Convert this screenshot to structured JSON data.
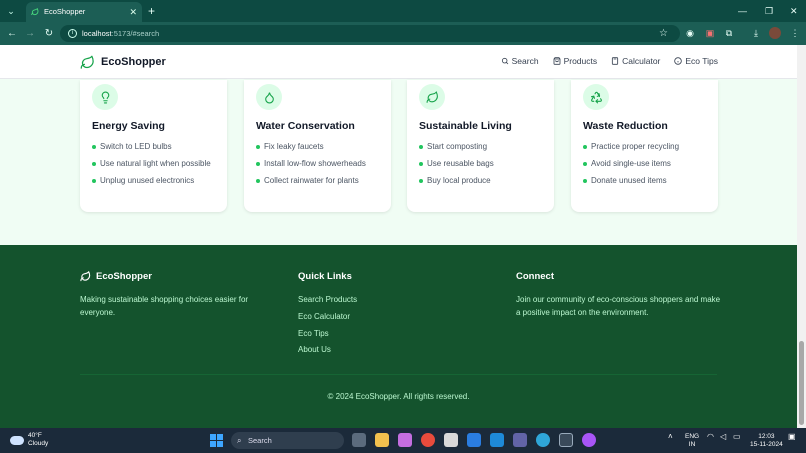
{
  "browser": {
    "tab_title": "EcoShopper",
    "url_host": "localhost",
    "url_rest": ":5173/#search"
  },
  "app": {
    "brand": "EcoShopper",
    "nav": [
      {
        "label": "Search",
        "icon": "search-icon"
      },
      {
        "label": "Products",
        "icon": "shopping-bag-icon"
      },
      {
        "label": "Calculator",
        "icon": "calculator-icon"
      },
      {
        "label": "Eco Tips",
        "icon": "info-icon"
      }
    ]
  },
  "tips": [
    {
      "title": "Energy Saving",
      "icon": "lightbulb-icon",
      "items": [
        "Switch to LED bulbs",
        "Use natural light when possible",
        "Unplug unused electronics"
      ]
    },
    {
      "title": "Water Conservation",
      "icon": "droplet-icon",
      "items": [
        "Fix leaky faucets",
        "Install low-flow showerheads",
        "Collect rainwater for plants"
      ]
    },
    {
      "title": "Sustainable Living",
      "icon": "leaf-icon",
      "items": [
        "Start composting",
        "Use reusable bags",
        "Buy local produce"
      ]
    },
    {
      "title": "Waste Reduction",
      "icon": "recycle-icon",
      "items": [
        "Practice proper recycling",
        "Avoid single-use items",
        "Donate unused items"
      ]
    }
  ],
  "footer": {
    "brand": "EcoShopper",
    "tagline": "Making sustainable shopping choices easier for everyone.",
    "quick_links_heading": "Quick Links",
    "quick_links": [
      "Search Products",
      "Eco Calculator",
      "Eco Tips",
      "About Us"
    ],
    "connect_heading": "Connect",
    "connect_text": "Join our community of eco-conscious shoppers and make a positive impact on the environment.",
    "copyright": "© 2024 EcoShopper. All rights reserved."
  },
  "taskbar": {
    "temperature": "40°F",
    "condition": "Cloudy",
    "search_label": "Search",
    "lang_top": "ENG",
    "lang_bottom": "IN",
    "time": "12:03",
    "date": "15-11-2024"
  },
  "colors": {
    "brand_green": "#16a34a",
    "footer_bg": "#14532d",
    "page_bg": "#f0fdf4",
    "browser_frame": "#0d4a42"
  }
}
